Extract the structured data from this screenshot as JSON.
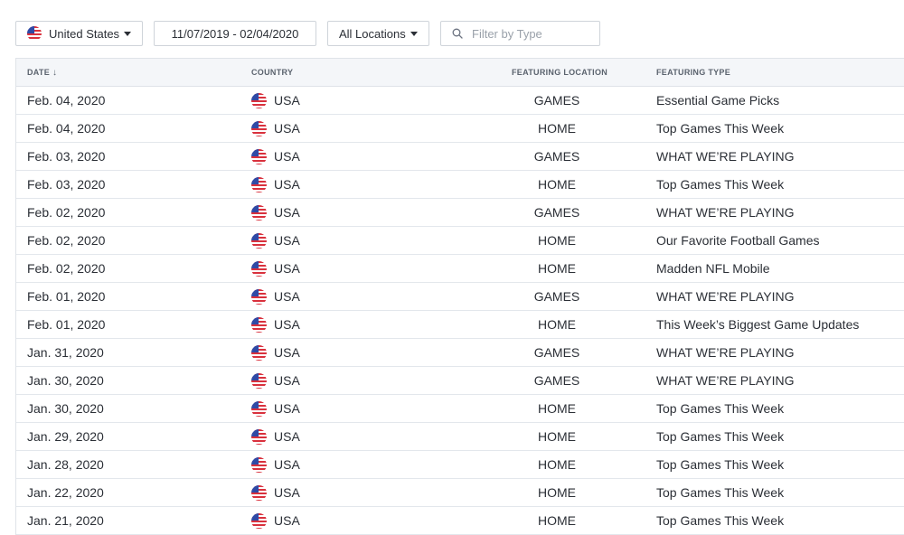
{
  "filters": {
    "country_label": "United States",
    "country_flag_icon": "us-flag-icon",
    "date_range": "11/07/2019 - 02/04/2020",
    "locations_label": "All Locations",
    "type_filter_placeholder": "Filter by Type",
    "search_icon": "search-icon"
  },
  "table": {
    "columns": {
      "date": "DATE",
      "date_sort_icon": "↓",
      "country": "COUNTRY",
      "location": "FEATURING LOCATION",
      "type": "FEATURING TYPE"
    },
    "rows": [
      {
        "date": "Feb. 04, 2020",
        "country": "USA",
        "location": "GAMES",
        "type": "Essential Game Picks"
      },
      {
        "date": "Feb. 04, 2020",
        "country": "USA",
        "location": "HOME",
        "type": "Top Games This Week"
      },
      {
        "date": "Feb. 03, 2020",
        "country": "USA",
        "location": "GAMES",
        "type": "WHAT WE’RE PLAYING"
      },
      {
        "date": "Feb. 03, 2020",
        "country": "USA",
        "location": "HOME",
        "type": "Top Games This Week"
      },
      {
        "date": "Feb. 02, 2020",
        "country": "USA",
        "location": "GAMES",
        "type": "WHAT WE’RE PLAYING"
      },
      {
        "date": "Feb. 02, 2020",
        "country": "USA",
        "location": "HOME",
        "type": "Our Favorite Football Games"
      },
      {
        "date": "Feb. 02, 2020",
        "country": "USA",
        "location": "HOME",
        "type": "Madden NFL Mobile"
      },
      {
        "date": "Feb. 01, 2020",
        "country": "USA",
        "location": "GAMES",
        "type": "WHAT WE’RE PLAYING"
      },
      {
        "date": "Feb. 01, 2020",
        "country": "USA",
        "location": "HOME",
        "type": "This Week’s Biggest Game Updates"
      },
      {
        "date": "Jan. 31, 2020",
        "country": "USA",
        "location": "GAMES",
        "type": "WHAT WE’RE PLAYING"
      },
      {
        "date": "Jan. 30, 2020",
        "country": "USA",
        "location": "GAMES",
        "type": "WHAT WE’RE PLAYING"
      },
      {
        "date": "Jan. 30, 2020",
        "country": "USA",
        "location": "HOME",
        "type": "Top Games This Week"
      },
      {
        "date": "Jan. 29, 2020",
        "country": "USA",
        "location": "HOME",
        "type": "Top Games This Week"
      },
      {
        "date": "Jan. 28, 2020",
        "country": "USA",
        "location": "HOME",
        "type": "Top Games This Week"
      },
      {
        "date": "Jan. 22, 2020",
        "country": "USA",
        "location": "HOME",
        "type": "Top Games This Week"
      },
      {
        "date": "Jan. 21, 2020",
        "country": "USA",
        "location": "HOME",
        "type": "Top Games This Week"
      }
    ]
  },
  "colors": {
    "header_bg": "#f4f6f9",
    "border": "#dfe3e8",
    "text": "#2b2f36",
    "header_text": "#5b636e",
    "flag_red": "#d9313d",
    "flag_blue": "#2f4aa6"
  }
}
